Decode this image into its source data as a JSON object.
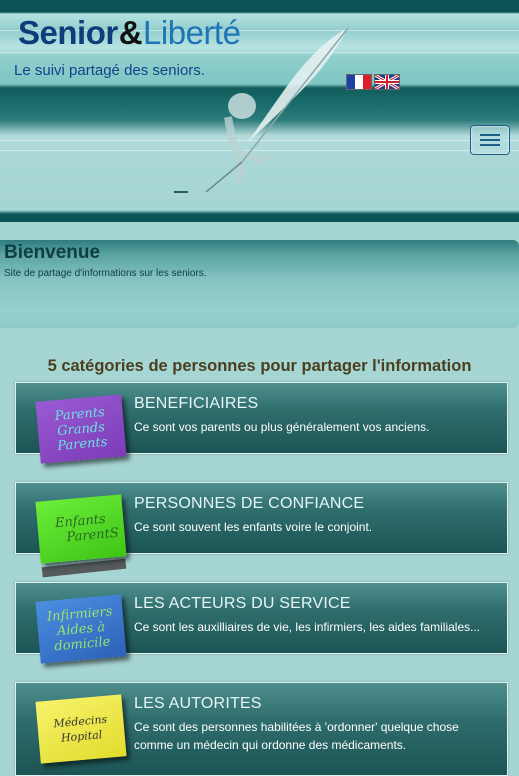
{
  "header": {
    "logo_part1": "Senior",
    "logo_amp": "&",
    "logo_part2": "Liberté",
    "tagline": "Le suivi partagé des seniors."
  },
  "languages": [
    "fr",
    "en"
  ],
  "welcome": {
    "title": "Bienvenue",
    "subtitle": "Site de partage d'informations sur les seniors."
  },
  "section_title": "5 catégories de personnes pour partager l'information",
  "categories": [
    {
      "note_lines": [
        "Parents",
        "Grands",
        "Parents"
      ],
      "note_color": "#8a47c4",
      "title": "BENEFICIAIRES",
      "description": "Ce sont vos parents ou plus généralement vos anciens."
    },
    {
      "note_lines": [
        "Enfants",
        "ParentS"
      ],
      "note_color": "#52d924",
      "title": "PERSONNES DE CONFIANCE",
      "description": "Ce sont souvent les enfants voire le conjoint."
    },
    {
      "note_lines": [
        "Infirmiers",
        "Aides à",
        "domicile"
      ],
      "note_color": "#3a78cf",
      "title": "LES ACTEURS DU SERVICE",
      "description": "Ce sont les auxilliaires de vie, les infirmiers, les aides familiales..."
    },
    {
      "note_lines": [
        "Médecins",
        "Hopital"
      ],
      "note_color": "#eee84a",
      "title": "LES AUTORITES",
      "description": "Ce sont des personnes habilitées à 'ordonner' quelque chose comme un médecin qui ordonne des médicaments."
    }
  ]
}
